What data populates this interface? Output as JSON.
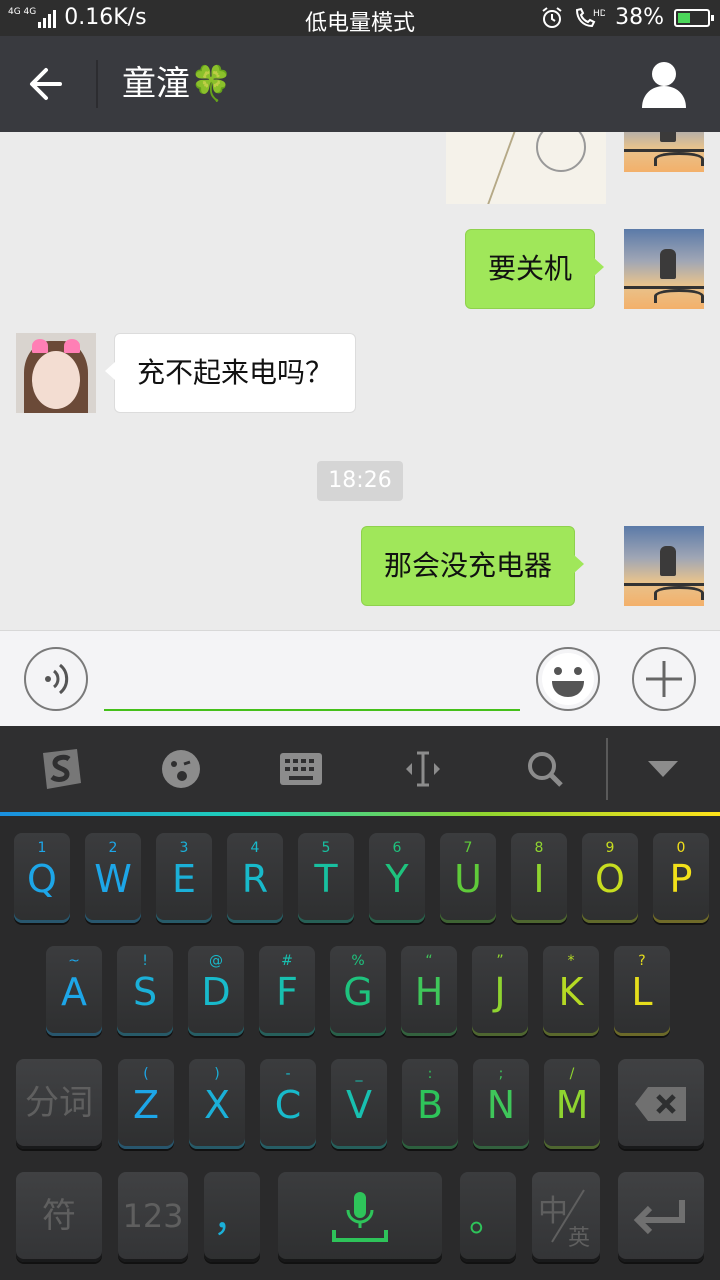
{
  "status_bar": {
    "network": "4G 4G",
    "speed": "0.16K/s",
    "mode": "低电量模式",
    "battery_percent": "38%",
    "battery_level": 0.38
  },
  "header": {
    "title": "童潼🍀"
  },
  "chat": {
    "messages": [
      {
        "from": "me",
        "text": "要关机"
      },
      {
        "from": "her",
        "text": "充不起来电吗？"
      },
      {
        "time": "18:26"
      },
      {
        "from": "me",
        "text": "那会没充电器"
      }
    ]
  },
  "input": {
    "value": "",
    "placeholder": ""
  },
  "keyboard": {
    "toolbar_icons": [
      "sogou-logo-icon",
      "emoji-icon",
      "keyboard-icon",
      "cursor-move-icon",
      "search-icon",
      "collapse-arrow-icon"
    ],
    "row1": [
      {
        "main": "Q",
        "sub": "1",
        "color": "#1da6e8"
      },
      {
        "main": "W",
        "sub": "2",
        "color": "#1da6e8"
      },
      {
        "main": "E",
        "sub": "3",
        "color": "#1bb0d8"
      },
      {
        "main": "R",
        "sub": "4",
        "color": "#18bacb"
      },
      {
        "main": "T",
        "sub": "5",
        "color": "#18c0a0"
      },
      {
        "main": "Y",
        "sub": "6",
        "color": "#1ec37e"
      },
      {
        "main": "U",
        "sub": "7",
        "color": "#5fcb3a"
      },
      {
        "main": "I",
        "sub": "8",
        "color": "#8fd430"
      },
      {
        "main": "O",
        "sub": "9",
        "color": "#c7dd20"
      },
      {
        "main": "P",
        "sub": "0",
        "color": "#f2e01a"
      }
    ],
    "row2": [
      {
        "main": "A",
        "sub": "~",
        "color": "#1da6e8"
      },
      {
        "main": "S",
        "sub": "!",
        "color": "#1bb0d8"
      },
      {
        "main": "D",
        "sub": "@",
        "color": "#18bacb"
      },
      {
        "main": "F",
        "sub": "#",
        "color": "#18c0b0"
      },
      {
        "main": "G",
        "sub": "%",
        "color": "#1ec37e"
      },
      {
        "main": "H",
        "sub": "“",
        "color": "#3fc75a"
      },
      {
        "main": "J",
        "sub": "”",
        "color": "#8fd430"
      },
      {
        "main": "K",
        "sub": "*",
        "color": "#b5da24"
      },
      {
        "main": "L",
        "sub": "?",
        "color": "#e6de1c"
      }
    ],
    "row3": [
      {
        "main": "Z",
        "sub": "(",
        "color": "#1da6e8"
      },
      {
        "main": "X",
        "sub": ")",
        "color": "#1bb0d8"
      },
      {
        "main": "C",
        "sub": "-",
        "color": "#18bacb"
      },
      {
        "main": "V",
        "sub": "_",
        "color": "#18c0b0"
      },
      {
        "main": "B",
        "sub": ":",
        "color": "#2ec45a"
      },
      {
        "main": "N",
        "sub": ";",
        "color": "#3fc75a"
      },
      {
        "main": "M",
        "sub": "/",
        "color": "#8fd430"
      }
    ],
    "fenci_label": "分词",
    "symbol_label": "符",
    "num_label": "123",
    "comma_label": "，",
    "period_label": "。",
    "lang_label_cn": "中",
    "lang_label_en": "英"
  }
}
